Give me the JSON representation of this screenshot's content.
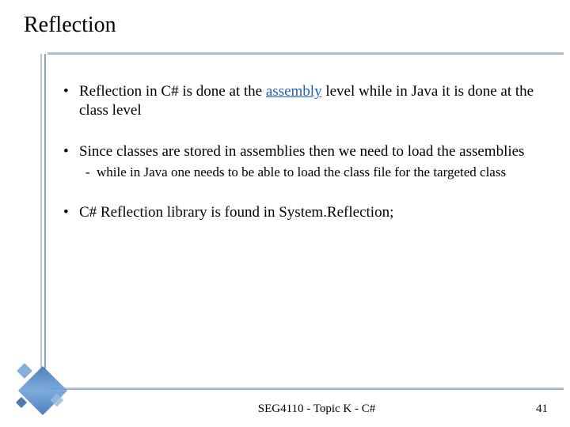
{
  "title": "Reflection",
  "bullets": {
    "b1_pre": "Reflection in C# is done at the ",
    "b1_link": "assembly",
    "b1_post": " level while in Java it is done at the class level",
    "b2": "Since classes are stored in assemblies then we need to load the assemblies",
    "b2_sub": "while in Java one needs to be able to load the class file for the targeted class",
    "b3": "C# Reflection library is found in System.Reflection;"
  },
  "footer": "SEG4110 - Topic K - C#",
  "page": "41"
}
